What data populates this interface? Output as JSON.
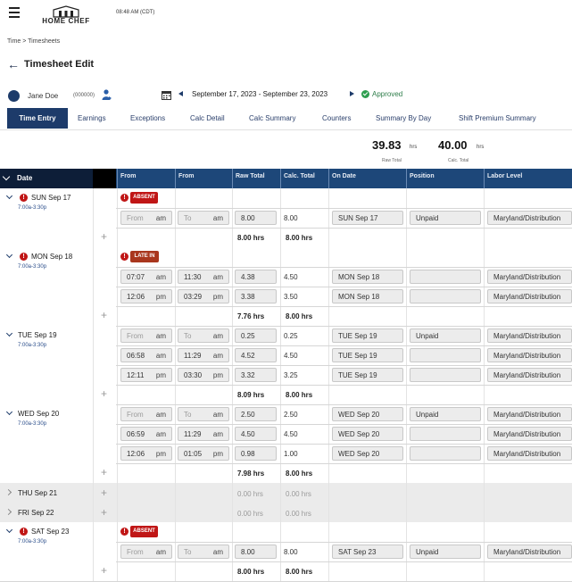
{
  "header": {
    "brand": "HOME CHEF",
    "clock": "08:48 AM (CDT)",
    "breadcrumb": "Time > Timesheets",
    "page_title": "Timesheet Edit"
  },
  "employee": {
    "name": "Jane Doe",
    "id": "(000000)",
    "period": "September 17, 2023 - September 23, 2023",
    "status": "Approved"
  },
  "tabs": [
    "Time Entry",
    "Earnings",
    "Exceptions",
    "Calc Detail",
    "Calc Summary",
    "Counters",
    "Summary By Day",
    "Shift Premium Summary"
  ],
  "totals": {
    "raw_value": "39.83",
    "raw_unit": "hrs",
    "raw_label": "Raw Total",
    "calc_value": "40.00",
    "calc_unit": "hrs",
    "calc_label": "Calc. Total"
  },
  "columns": {
    "date": "Date",
    "from": "From",
    "to": "From",
    "raw": "Raw Total",
    "calc": "Calc. Total",
    "on_date": "On Date",
    "position": "Position",
    "labor": "Labor Level"
  },
  "days": [
    {
      "label": "SUN Sep 17",
      "schedule": "7:00a-3:30p",
      "badge": "ABSENT",
      "entries": [
        {
          "from": "From",
          "from_ampm": "am",
          "to": "To",
          "to_ampm": "am",
          "raw": "8.00",
          "calc": "8.00",
          "date": "SUN Sep 17",
          "position": "Unpaid",
          "labor": "Maryland/Distribution"
        }
      ],
      "raw_total": "8.00 hrs",
      "calc_total": "8.00 hrs"
    },
    {
      "label": "MON Sep 18",
      "schedule": "7:00a-3:30p",
      "badge": "LATE IN",
      "entries": [
        {
          "from": "07:07",
          "from_ampm": "am",
          "to": "11:30",
          "to_ampm": "am",
          "raw": "4.38",
          "calc": "4.50",
          "date": "MON Sep 18",
          "position": "",
          "labor": "Maryland/Distribution"
        },
        {
          "from": "12:06",
          "from_ampm": "pm",
          "to": "03:29",
          "to_ampm": "pm",
          "raw": "3.38",
          "calc": "3.50",
          "date": "MON Sep 18",
          "position": "",
          "labor": "Maryland/Distribution"
        }
      ],
      "raw_total": "7.76 hrs",
      "calc_total": "8.00 hrs"
    },
    {
      "label": "TUE Sep 19",
      "schedule": "7:00a-3:30p",
      "badge": "",
      "entries": [
        {
          "from": "From",
          "from_ampm": "am",
          "to": "To",
          "to_ampm": "am",
          "raw": "0.25",
          "calc": "0.25",
          "date": "TUE Sep 19",
          "position": "Unpaid",
          "labor": "Maryland/Distribution"
        },
        {
          "from": "06:58",
          "from_ampm": "am",
          "to": "11:29",
          "to_ampm": "am",
          "raw": "4.52",
          "calc": "4.50",
          "date": "TUE Sep 19",
          "position": "",
          "labor": "Maryland/Distribution"
        },
        {
          "from": "12:11",
          "from_ampm": "pm",
          "to": "03:30",
          "to_ampm": "pm",
          "raw": "3.32",
          "calc": "3.25",
          "date": "TUE Sep 19",
          "position": "",
          "labor": "Maryland/Distribution"
        }
      ],
      "raw_total": "8.09 hrs",
      "calc_total": "8.00 hrs"
    },
    {
      "label": "WED Sep 20",
      "schedule": "7:00a-3:30p",
      "badge": "",
      "entries": [
        {
          "from": "From",
          "from_ampm": "am",
          "to": "To",
          "to_ampm": "am",
          "raw": "2.50",
          "calc": "2.50",
          "date": "WED Sep 20",
          "position": "Unpaid",
          "labor": "Maryland/Distribution"
        },
        {
          "from": "06:59",
          "from_ampm": "am",
          "to": "11:29",
          "to_ampm": "am",
          "raw": "4.50",
          "calc": "4.50",
          "date": "WED Sep 20",
          "position": "",
          "labor": "Maryland/Distribution"
        },
        {
          "from": "12:06",
          "from_ampm": "pm",
          "to": "01:05",
          "to_ampm": "pm",
          "raw": "0.98",
          "calc": "1.00",
          "date": "WED Sep 20",
          "position": "",
          "labor": "Maryland/Distribution"
        }
      ],
      "raw_total": "7.98 hrs",
      "calc_total": "8.00 hrs"
    },
    {
      "label": "THU Sep 21",
      "schedule": "",
      "badge": "",
      "entries": [],
      "raw_total": "0.00 hrs",
      "calc_total": "0.00 hrs"
    },
    {
      "label": "FRI Sep 22",
      "schedule": "",
      "badge": "",
      "entries": [],
      "raw_total": "0.00 hrs",
      "calc_total": "0.00 hrs"
    },
    {
      "label": "SAT Sep 23",
      "schedule": "7:00a-3:30p",
      "badge": "ABSENT",
      "entries": [
        {
          "from": "From",
          "from_ampm": "am",
          "to": "To",
          "to_ampm": "am",
          "raw": "8.00",
          "calc": "8.00",
          "date": "SAT Sep 23",
          "position": "Unpaid",
          "labor": "Maryland/Distribution"
        }
      ],
      "raw_total": "8.00 hrs",
      "calc_total": "8.00 hrs"
    }
  ],
  "colors": {
    "brand_navy": "#1d3b6a",
    "header_blue": "#1d4779",
    "absent_red": "#c01616",
    "late_red": "#a9361d",
    "approved_green": "#2e9e4f"
  }
}
